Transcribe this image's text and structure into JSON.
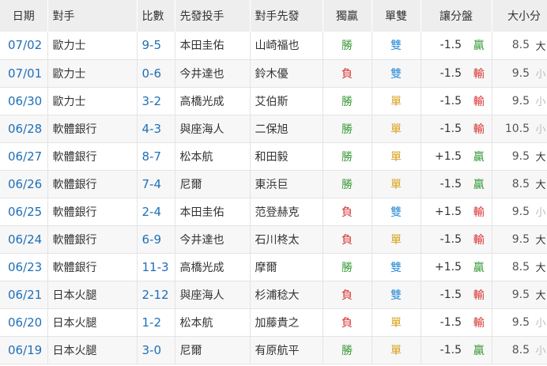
{
  "headers": {
    "date": "日期",
    "opponent": "對手",
    "score": "比數",
    "starter": "先發投手",
    "opp_starter": "對手先發",
    "win_loss": "獨贏",
    "odd_even": "單雙",
    "spread": "讓分盤",
    "over_under": "大小分"
  },
  "colors": {
    "win": "#3a9a3a",
    "loss": "#d83030",
    "odd": "#d8a21e",
    "even": "#2f8ed8",
    "over": "#333333",
    "under": "#bbbbbb",
    "link": "#1e6fb8"
  },
  "rows": [
    {
      "date": "07/02",
      "opponent": "歐力士",
      "score": "9-5",
      "starter": "本田圭佑",
      "opp_starter": "山崎福也",
      "wl": "勝",
      "wl_color": "#3a9a3a",
      "oe": "雙",
      "oe_color": "#2f8ed8",
      "line": "-1.5",
      "line_res": "贏",
      "line_color": "#3a9a3a",
      "total": "8.5",
      "ou": "大",
      "ou_color": "#333333"
    },
    {
      "date": "07/01",
      "opponent": "歐力士",
      "score": "0-6",
      "starter": "今井達也",
      "opp_starter": "鈴木優",
      "wl": "負",
      "wl_color": "#d83030",
      "oe": "雙",
      "oe_color": "#2f8ed8",
      "line": "-1.5",
      "line_res": "輸",
      "line_color": "#d83030",
      "total": "9.5",
      "ou": "小",
      "ou_color": "#bbbbbb"
    },
    {
      "date": "06/30",
      "opponent": "歐力士",
      "score": "3-2",
      "starter": "高橋光成",
      "opp_starter": "艾伯斯",
      "wl": "勝",
      "wl_color": "#3a9a3a",
      "oe": "單",
      "oe_color": "#d8a21e",
      "line": "-1.5",
      "line_res": "輸",
      "line_color": "#d83030",
      "total": "9.5",
      "ou": "小",
      "ou_color": "#bbbbbb"
    },
    {
      "date": "06/28",
      "opponent": "軟體銀行",
      "score": "4-3",
      "starter": "與座海人",
      "opp_starter": "二保旭",
      "wl": "勝",
      "wl_color": "#3a9a3a",
      "oe": "單",
      "oe_color": "#d8a21e",
      "line": "-1.5",
      "line_res": "輸",
      "line_color": "#d83030",
      "total": "10.5",
      "ou": "小",
      "ou_color": "#bbbbbb"
    },
    {
      "date": "06/27",
      "opponent": "軟體銀行",
      "score": "8-7",
      "starter": "松本航",
      "opp_starter": "和田毅",
      "wl": "勝",
      "wl_color": "#3a9a3a",
      "oe": "單",
      "oe_color": "#d8a21e",
      "line": "+1.5",
      "line_res": "贏",
      "line_color": "#3a9a3a",
      "total": "9.5",
      "ou": "大",
      "ou_color": "#333333"
    },
    {
      "date": "06/26",
      "opponent": "軟體銀行",
      "score": "7-4",
      "starter": "尼爾",
      "opp_starter": "東浜巨",
      "wl": "勝",
      "wl_color": "#3a9a3a",
      "oe": "單",
      "oe_color": "#d8a21e",
      "line": "-1.5",
      "line_res": "贏",
      "line_color": "#3a9a3a",
      "total": "8.5",
      "ou": "大",
      "ou_color": "#333333"
    },
    {
      "date": "06/25",
      "opponent": "軟體銀行",
      "score": "2-4",
      "starter": "本田圭佑",
      "opp_starter": "范登赫克",
      "wl": "負",
      "wl_color": "#d83030",
      "oe": "雙",
      "oe_color": "#2f8ed8",
      "line": "+1.5",
      "line_res": "輸",
      "line_color": "#d83030",
      "total": "9.5",
      "ou": "小",
      "ou_color": "#bbbbbb"
    },
    {
      "date": "06/24",
      "opponent": "軟體銀行",
      "score": "6-9",
      "starter": "今井達也",
      "opp_starter": "石川柊太",
      "wl": "負",
      "wl_color": "#d83030",
      "oe": "單",
      "oe_color": "#d8a21e",
      "line": "-1.5",
      "line_res": "輸",
      "line_color": "#d83030",
      "total": "9.5",
      "ou": "大",
      "ou_color": "#333333"
    },
    {
      "date": "06/23",
      "opponent": "軟體銀行",
      "score": "11-3",
      "starter": "高橋光成",
      "opp_starter": "摩爾",
      "wl": "勝",
      "wl_color": "#3a9a3a",
      "oe": "雙",
      "oe_color": "#2f8ed8",
      "line": "+1.5",
      "line_res": "贏",
      "line_color": "#3a9a3a",
      "total": "8.5",
      "ou": "大",
      "ou_color": "#333333"
    },
    {
      "date": "06/21",
      "opponent": "日本火腿",
      "score": "2-12",
      "starter": "與座海人",
      "opp_starter": "杉浦稔大",
      "wl": "負",
      "wl_color": "#d83030",
      "oe": "雙",
      "oe_color": "#2f8ed8",
      "line": "-1.5",
      "line_res": "輸",
      "line_color": "#d83030",
      "total": "9.5",
      "ou": "大",
      "ou_color": "#333333"
    },
    {
      "date": "06/20",
      "opponent": "日本火腿",
      "score": "1-2",
      "starter": "松本航",
      "opp_starter": "加藤貴之",
      "wl": "負",
      "wl_color": "#d83030",
      "oe": "單",
      "oe_color": "#d8a21e",
      "line": "-1.5",
      "line_res": "輸",
      "line_color": "#d83030",
      "total": "9.5",
      "ou": "小",
      "ou_color": "#bbbbbb"
    },
    {
      "date": "06/19",
      "opponent": "日本火腿",
      "score": "3-0",
      "starter": "尼爾",
      "opp_starter": "有原航平",
      "wl": "勝",
      "wl_color": "#3a9a3a",
      "oe": "單",
      "oe_color": "#d8a21e",
      "line": "-1.5",
      "line_res": "贏",
      "line_color": "#3a9a3a",
      "total": "8.5",
      "ou": "小",
      "ou_color": "#bbbbbb"
    }
  ]
}
